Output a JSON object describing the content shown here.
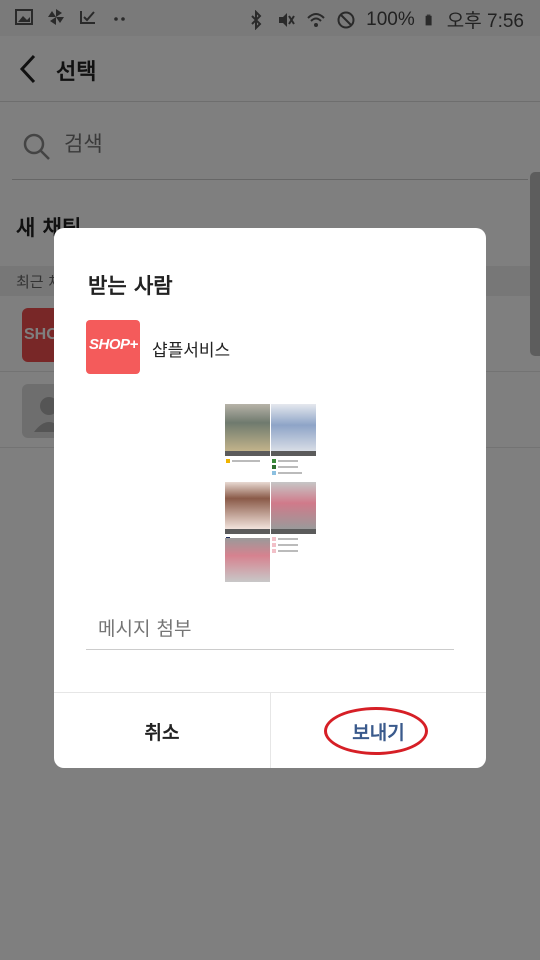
{
  "status_bar": {
    "battery": "100%",
    "time": "오후 7:56",
    "left_icons": [
      "gallery-icon",
      "pinwheel-icon",
      "check-icon",
      "more-dots-icon"
    ],
    "right_icons": [
      "bluetooth-icon",
      "mute-icon",
      "wifi-icon",
      "block-icon",
      "battery-icon"
    ]
  },
  "header": {
    "title": "선택"
  },
  "search": {
    "placeholder": "검색"
  },
  "section": {
    "new_chat": "새 채팅",
    "recent": "최근 채팅"
  },
  "rows": [
    {
      "avatar_text": "SHOP+"
    },
    {
      "avatar_text": ""
    }
  ],
  "dialog": {
    "title": "받는 사람",
    "recipient": {
      "name": "샵플서비스",
      "logo_text": "SHOP+"
    },
    "message_placeholder": "메시지 첨부",
    "cancel_label": "취소",
    "send_label": "보내기"
  },
  "colors": {
    "overlay": "#000000",
    "brand_red": "#f45b5b",
    "send_blue": "#3a5a8c",
    "annotation_red": "#d61f26"
  }
}
